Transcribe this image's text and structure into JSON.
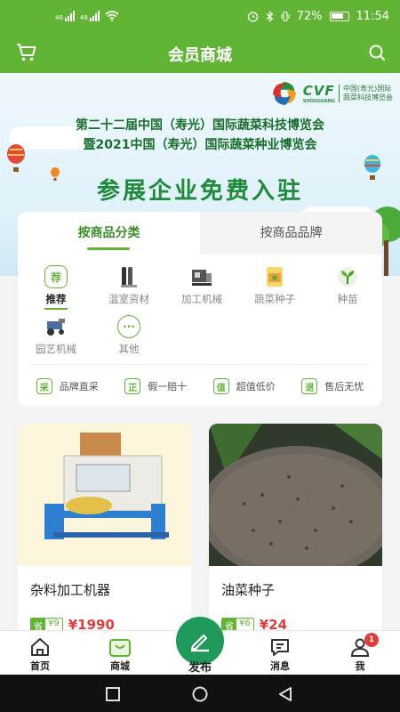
{
  "status_bar": {
    "signal_1": "46",
    "signal_2": "46",
    "battery": "72%",
    "time": "11:54"
  },
  "app_bar": {
    "title": "会员商城",
    "left_icon": "cart-icon",
    "right_icon": "search-icon"
  },
  "banner": {
    "logo_text": "CVF",
    "logo_sub": "SHOUGUANG",
    "logo_cn_1": "中国(寿光)国际",
    "logo_cn_2": "蔬菜科技博览会",
    "line1": "第二十二届中国（寿光）国际蔬菜科技博览会",
    "line2": "暨2021中国（寿光）国际蔬菜种业博览会",
    "headline": "参展企业免费入驻"
  },
  "category": {
    "tabs": [
      {
        "label": "按商品分类",
        "active": true
      },
      {
        "label": "按商品品牌",
        "active": false
      }
    ],
    "items": [
      {
        "label": "推荐",
        "icon": "recommend-icon",
        "glyph": "荐",
        "selected": true
      },
      {
        "label": "温室资材",
        "icon": "greenhouse-material-icon",
        "glyph": "",
        "selected": false
      },
      {
        "label": "加工机械",
        "icon": "processing-machine-icon",
        "glyph": "",
        "selected": false
      },
      {
        "label": "蔬菜种子",
        "icon": "vegetable-seeds-icon",
        "glyph": "",
        "selected": false
      },
      {
        "label": "种苗",
        "icon": "seedling-icon",
        "glyph": "",
        "selected": false
      },
      {
        "label": "园艺机械",
        "icon": "garden-machine-icon",
        "glyph": "",
        "selected": false
      },
      {
        "label": "其他",
        "icon": "more-icon",
        "glyph": "···",
        "selected": false
      }
    ],
    "features": [
      {
        "badge": "采",
        "label": "品牌直采"
      },
      {
        "badge": "正",
        "label": "假一赔十"
      },
      {
        "badge": "值",
        "label": "超值低价"
      },
      {
        "badge": "退",
        "label": "售后无忧"
      }
    ]
  },
  "products": [
    {
      "name": "杂料加工机器",
      "save_label": "省",
      "save_amount": "¥9",
      "price": "¥1990"
    },
    {
      "name": "油菜种子",
      "save_label": "省",
      "save_amount": "¥6",
      "price": "¥24"
    }
  ],
  "bottom_nav": {
    "items": [
      {
        "label": "首页",
        "icon": "home-icon"
      },
      {
        "label": "商城",
        "icon": "mall-icon"
      },
      {
        "label": "发布",
        "icon": "publish-icon"
      },
      {
        "label": "消息",
        "icon": "message-icon"
      },
      {
        "label": "我",
        "icon": "profile-icon",
        "badge": "1"
      }
    ]
  },
  "colors": {
    "brand_green": "#62b435",
    "price_red": "#e23b3b",
    "publish_green": "#1f9a5b"
  }
}
